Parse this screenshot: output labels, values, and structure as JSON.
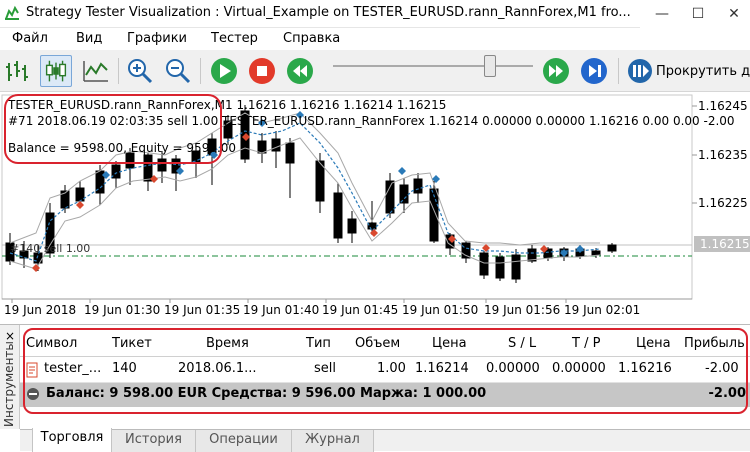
{
  "window": {
    "title": "Strategy Tester Visualization : Virtual_Example on TESTER_EURUSD.rann_RannForex,M1 fro...",
    "minimize": "—",
    "maximize": "☐",
    "close": "✕"
  },
  "menu": {
    "items": [
      "Файл",
      "Вид",
      "Графики",
      "Тестер",
      "Справка"
    ]
  },
  "toolbar": {
    "scroll_label": "Прокрутить д"
  },
  "chart": {
    "overlay_line1": "TESTER_EURUSD.rann_RannForex,M1  1.16216 1.16216 1.16214 1.16215",
    "overlay_line2": "#71 2018.06.19 02:03:35 sell 1.00 TESTER_EURUSD.rann_RannForex 1.16214 0.00000 0.00000 1.16216 0.00 0.00 -2.00",
    "overlay_line3": "Balance = 9598.00, Equity = 9596.00",
    "order_label": "#140 sell 1.00",
    "price_labels": [
      "1.16245",
      "1.16235",
      "1.16225"
    ],
    "current_price": "1.16215",
    "time_labels": [
      "19 Jun 2018",
      "19 Jun 01:30",
      "19 Jun 01:35",
      "19 Jun 01:40",
      "19 Jun 01:45",
      "19 Jun 01:50",
      "19 Jun 01:56",
      "19 Jun 02:01"
    ],
    "colors": {
      "trade_line": "#2a7ab8",
      "level_line": "#1a8a3a",
      "sell_marker": "#2a7ab8",
      "buy_marker": "#d9482e"
    }
  },
  "panel": {
    "side_label": "Инструменты",
    "close": "×",
    "columns": [
      "Символ",
      "Тикет",
      "Время",
      "Тип",
      "Объем",
      "Цена",
      "S / L",
      "T / P",
      "Цена",
      "Прибыль"
    ],
    "row": {
      "symbol": "tester_...",
      "ticket": "140",
      "time": "2018.06.1...",
      "type": "sell",
      "volume": "1.00",
      "price": "1.16214",
      "sl": "0.00000",
      "tp": "0.00000",
      "cur_price": "1.16216",
      "profit": "-2.00"
    },
    "summary": {
      "text": "Баланс: 9 598.00 EUR  Средства: 9 596.00  Маржа: 1 000.00",
      "profit": "-2.00"
    },
    "tabs": [
      "Торговля",
      "История",
      "Операции",
      "Журнал"
    ]
  }
}
